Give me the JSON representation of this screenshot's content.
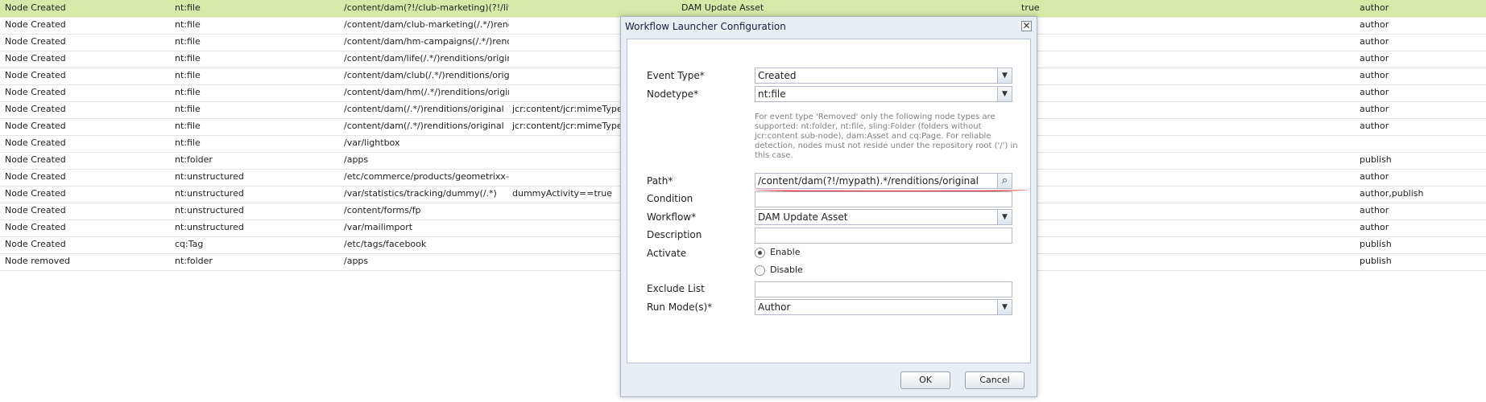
{
  "table": {
    "rows": [
      {
        "event": "Node Created",
        "nodetype": "nt:file",
        "path": "/content/dam(?!/club-marketing)(?!/lif…",
        "condition": "",
        "workflow": "DAM Update Asset",
        "activate": "true",
        "runmode": "author",
        "selected": true
      },
      {
        "event": "Node Created",
        "nodetype": "nt:file",
        "path": "/content/dam/club-marketing(/.*/)rend…",
        "condition": "",
        "workflow": "",
        "activate": "",
        "runmode": "author"
      },
      {
        "event": "Node Created",
        "nodetype": "nt:file",
        "path": "/content/dam/hm-campaigns(/.*/)rend…",
        "condition": "",
        "workflow": "",
        "activate": "",
        "runmode": "author"
      },
      {
        "event": "Node Created",
        "nodetype": "nt:file",
        "path": "/content/dam/life(/.*/)renditions/original",
        "condition": "",
        "workflow": "",
        "activate": "",
        "runmode": "author"
      },
      {
        "event": "Node Created",
        "nodetype": "nt:file",
        "path": "/content/dam/club(/.*/)renditions/origi…",
        "condition": "",
        "workflow": "",
        "activate": "",
        "runmode": "author"
      },
      {
        "event": "Node Created",
        "nodetype": "nt:file",
        "path": "/content/dam/hm(/.*/)renditions/original",
        "condition": "",
        "workflow": "",
        "activate": "",
        "runmode": "author"
      },
      {
        "event": "Node Created",
        "nodetype": "nt:file",
        "path": "/content/dam(/.*/)renditions/original",
        "condition": "jcr:content/jcr:mimeType=",
        "workflow": "",
        "activate": "",
        "runmode": "author"
      },
      {
        "event": "Node Created",
        "nodetype": "nt:file",
        "path": "/content/dam(/.*/)renditions/original",
        "condition": "jcr:content/jcr:mimeType=",
        "workflow": "",
        "activate": "",
        "runmode": "author"
      },
      {
        "event": "Node Created",
        "nodetype": "nt:file",
        "path": "/var/lightbox",
        "condition": "",
        "workflow": "",
        "activate": "",
        "runmode": ""
      },
      {
        "event": "Node Created",
        "nodetype": "nt:folder",
        "path": "/apps",
        "condition": "",
        "workflow": "",
        "activate": "",
        "runmode": "publish"
      },
      {
        "event": "Node Created",
        "nodetype": "nt:unstructured",
        "path": "/etc/commerce/products/geometrixx-o…",
        "condition": "",
        "workflow": "",
        "activate": "",
        "runmode": "author"
      },
      {
        "event": "Node Created",
        "nodetype": "nt:unstructured",
        "path": "/var/statistics/tracking/dummy(/.*)",
        "condition": "dummyActivity==true",
        "workflow": "",
        "activate": "",
        "runmode": "author,publish"
      },
      {
        "event": "Node Created",
        "nodetype": "nt:unstructured",
        "path": "/content/forms/fp",
        "condition": "",
        "workflow": "",
        "activate": "",
        "runmode": "author"
      },
      {
        "event": "Node Created",
        "nodetype": "nt:unstructured",
        "path": "/var/mailimport",
        "condition": "",
        "workflow": "",
        "activate": "",
        "runmode": "author"
      },
      {
        "event": "Node Created",
        "nodetype": "cq:Tag",
        "path": "/etc/tags/facebook",
        "condition": "",
        "workflow": "",
        "activate": "",
        "runmode": "publish"
      },
      {
        "event": "Node removed",
        "nodetype": "nt:folder",
        "path": "/apps",
        "condition": "",
        "workflow": "",
        "activate": "",
        "runmode": "publish"
      }
    ]
  },
  "dialog": {
    "title": "Workflow Launcher Configuration",
    "close_glyph": "✕",
    "dropdown_glyph": "▼",
    "search_glyph": "⌕",
    "event_type": {
      "label": "Event Type*",
      "value": "Created"
    },
    "nodetype": {
      "label": "Nodetype*",
      "value": "nt:file"
    },
    "nodetype_help": "For event type 'Removed' only the following node types are supported: nt:folder, nt:file, sling:Folder (folders without jcr:content sub-node), dam:Asset and cq:Page. For reliable detection, nodes must not reside under the repository root ('/') in this case.",
    "path": {
      "label": "Path*",
      "value": "/content/dam(?!/mypath).*/renditions/original"
    },
    "condition": {
      "label": "Condition",
      "value": ""
    },
    "workflow": {
      "label": "Workflow*",
      "value": "DAM Update Asset"
    },
    "description": {
      "label": "Description",
      "value": ""
    },
    "activate": {
      "label": "Activate",
      "enable": "Enable",
      "disable": "Disable"
    },
    "exclude_list": {
      "label": "Exclude List",
      "value": ""
    },
    "run_modes": {
      "label": "Run Mode(s)*",
      "value": "Author"
    },
    "ok_label": "OK",
    "cancel_label": "Cancel"
  }
}
